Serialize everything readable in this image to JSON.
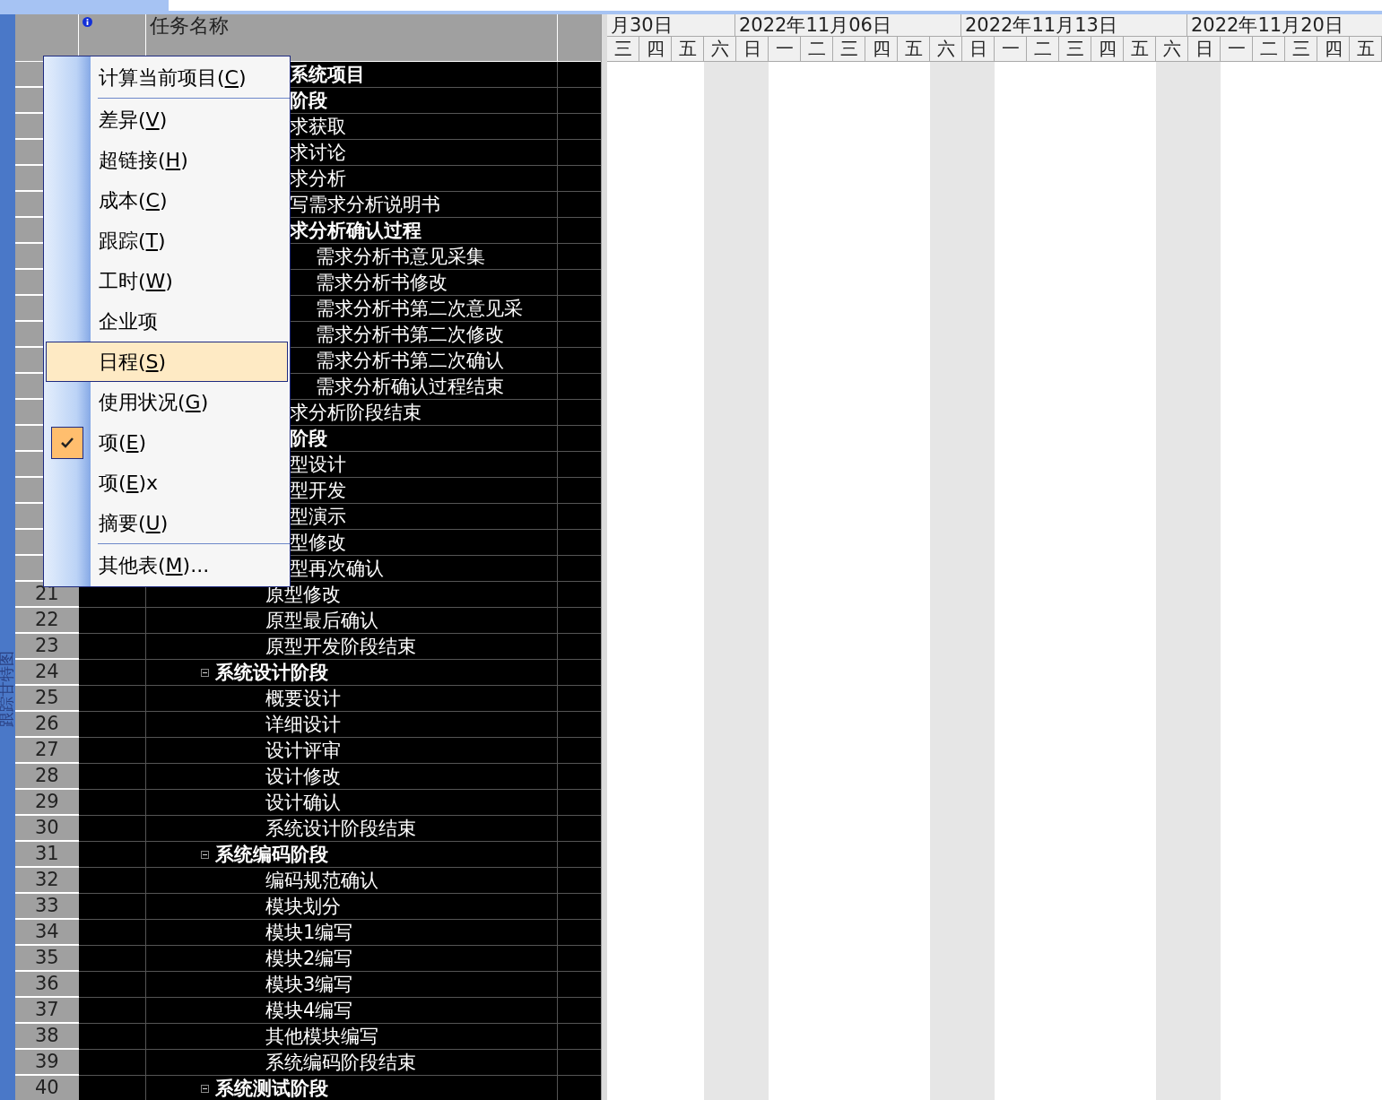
{
  "view_bar": {
    "label": "跟踪甘特图"
  },
  "table": {
    "columns": [
      {
        "kind": "info_icon"
      },
      {
        "kind": "text",
        "label": "任务名称"
      }
    ],
    "rows": [
      {
        "kind": "summary",
        "name": "系统项目",
        "children": [
          {
            "kind": "summary",
            "name": "阶段",
            "children": [
              {
                "kind": "task",
                "name": "求获取"
              },
              {
                "kind": "task",
                "name": "求讨论"
              },
              {
                "kind": "task",
                "name": "求分析"
              },
              {
                "kind": "task",
                "name": "写需求分析说明书"
              },
              {
                "kind": "summary",
                "name": "求分析确认过程",
                "children": [
                  {
                    "kind": "task",
                    "name": "需求分析书意见采集"
                  },
                  {
                    "kind": "task",
                    "name": "需求分析书修改"
                  },
                  {
                    "kind": "task",
                    "name": "需求分析书第二次意见采"
                  },
                  {
                    "kind": "task",
                    "name": "需求分析书第二次修改"
                  },
                  {
                    "kind": "task",
                    "name": "需求分析书第二次确认"
                  },
                  {
                    "kind": "task",
                    "name": "需求分析确认过程结束"
                  }
                ]
              },
              {
                "kind": "task",
                "name": "求分析阶段结束"
              }
            ]
          },
          {
            "kind": "summary",
            "name": "阶段",
            "children": [
              {
                "kind": "task",
                "name": "型设计"
              },
              {
                "kind": "task",
                "name": "型开发"
              },
              {
                "kind": "task",
                "name": "型演示"
              },
              {
                "kind": "task",
                "name": "型修改"
              },
              {
                "kind": "task",
                "name": "型再次确认"
              },
              {
                "kind": "task",
                "id": "21",
                "name": "原型修改"
              },
              {
                "kind": "task",
                "id": "22",
                "name": "原型最后确认"
              },
              {
                "kind": "task",
                "id": "23",
                "name": "原型开发阶段结束"
              }
            ]
          },
          {
            "kind": "summary",
            "id": "24",
            "name": "系统设计阶段",
            "expanded": true,
            "children": [
              {
                "kind": "task",
                "id": "25",
                "name": "概要设计"
              },
              {
                "kind": "task",
                "id": "26",
                "name": "详细设计"
              },
              {
                "kind": "task",
                "id": "27",
                "name": "设计评审"
              },
              {
                "kind": "task",
                "id": "28",
                "name": "设计修改"
              },
              {
                "kind": "task",
                "id": "29",
                "name": "设计确认"
              },
              {
                "kind": "task",
                "id": "30",
                "name": "系统设计阶段结束"
              }
            ]
          },
          {
            "kind": "summary",
            "id": "31",
            "name": "系统编码阶段",
            "expanded": true,
            "children": [
              {
                "kind": "task",
                "id": "32",
                "name": "编码规范确认"
              },
              {
                "kind": "task",
                "id": "33",
                "name": "模块划分"
              },
              {
                "kind": "task",
                "id": "34",
                "name": "模块1编写"
              },
              {
                "kind": "task",
                "id": "35",
                "name": "模块2编写"
              },
              {
                "kind": "task",
                "id": "36",
                "name": "模块3编写"
              },
              {
                "kind": "task",
                "id": "37",
                "name": "模块4编写"
              },
              {
                "kind": "task",
                "id": "38",
                "name": "其他模块编写"
              },
              {
                "kind": "task",
                "id": "39",
                "name": "系统编码阶段结束"
              }
            ]
          },
          {
            "kind": "summary",
            "id": "40",
            "name": "系统测试阶段",
            "expanded": true
          }
        ]
      }
    ]
  },
  "gantt": {
    "weeks": [
      {
        "label": "月30日",
        "days": [
          {
            "label": "三",
            "nonworking": false
          },
          {
            "label": "四",
            "nonworking": false
          },
          {
            "label": "五",
            "nonworking": false
          },
          {
            "label": "六",
            "nonworking": true
          }
        ]
      },
      {
        "label": "2022年11月06日",
        "days": [
          {
            "label": "日",
            "nonworking": true
          },
          {
            "label": "一",
            "nonworking": false
          },
          {
            "label": "二",
            "nonworking": false
          },
          {
            "label": "三",
            "nonworking": false
          },
          {
            "label": "四",
            "nonworking": false
          },
          {
            "label": "五",
            "nonworking": false
          },
          {
            "label": "六",
            "nonworking": true
          }
        ]
      },
      {
        "label": "2022年11月13日",
        "days": [
          {
            "label": "日",
            "nonworking": true
          },
          {
            "label": "一",
            "nonworking": false
          },
          {
            "label": "二",
            "nonworking": false
          },
          {
            "label": "三",
            "nonworking": false
          },
          {
            "label": "四",
            "nonworking": false
          },
          {
            "label": "五",
            "nonworking": false
          },
          {
            "label": "六",
            "nonworking": true
          }
        ]
      },
      {
        "label": "2022年11月20日",
        "days": [
          {
            "label": "日",
            "nonworking": true
          },
          {
            "label": "一",
            "nonworking": false
          },
          {
            "label": "二",
            "nonworking": false
          },
          {
            "label": "三",
            "nonworking": false
          },
          {
            "label": "四",
            "nonworking": false
          },
          {
            "label": "五",
            "nonworking": false
          }
        ]
      }
    ]
  },
  "context_menu": {
    "items": [
      {
        "kind": "command",
        "before": "计算当前项目(",
        "mnemonic": "C",
        "after": ")",
        "checked": false,
        "selected": false
      },
      {
        "kind": "separator"
      },
      {
        "kind": "command",
        "before": "差异(",
        "mnemonic": "V",
        "after": ")",
        "checked": false,
        "selected": false
      },
      {
        "kind": "command",
        "before": "超链接(",
        "mnemonic": "H",
        "after": ")",
        "checked": false,
        "selected": false
      },
      {
        "kind": "command",
        "before": "成本(",
        "mnemonic": "C",
        "after": ")",
        "checked": false,
        "selected": false
      },
      {
        "kind": "command",
        "before": "跟踪(",
        "mnemonic": "T",
        "after": ")",
        "checked": false,
        "selected": false
      },
      {
        "kind": "command",
        "before": "工时(",
        "mnemonic": "W",
        "after": ")",
        "checked": false,
        "selected": false
      },
      {
        "kind": "command",
        "before": "企业项",
        "checked": false,
        "selected": false
      },
      {
        "kind": "command",
        "before": "日程(",
        "mnemonic": "S",
        "after": ")",
        "checked": false,
        "selected": true
      },
      {
        "kind": "command",
        "before": "使用状况(",
        "mnemonic": "G",
        "after": ")",
        "checked": false,
        "selected": false
      },
      {
        "kind": "command",
        "before": "项(",
        "mnemonic": "E",
        "after": ")",
        "checked": true,
        "selected": false
      },
      {
        "kind": "command",
        "before": "项(",
        "mnemonic": "E",
        "after": ")x",
        "checked": false,
        "selected": false
      },
      {
        "kind": "command",
        "before": "摘要(",
        "mnemonic": "U",
        "after": ")",
        "checked": false,
        "selected": false
      },
      {
        "kind": "separator"
      },
      {
        "kind": "command",
        "before": "其他表(",
        "mnemonic": "M",
        "after": ")...",
        "checked": false,
        "selected": false
      }
    ]
  }
}
